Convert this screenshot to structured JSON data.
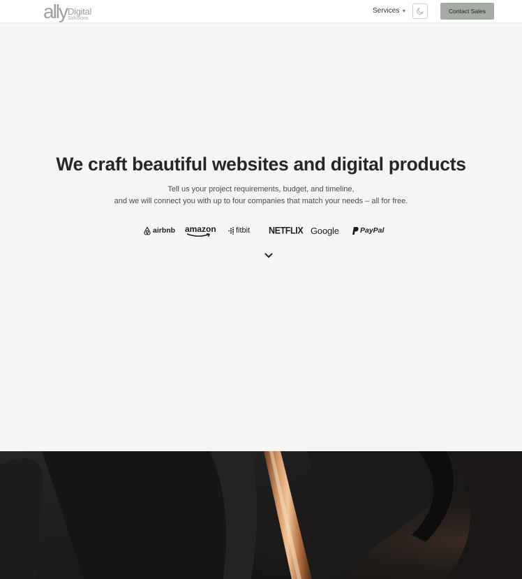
{
  "header": {
    "logo": {
      "main": "ally",
      "line1": "Digital",
      "line2": "Solutions"
    },
    "nav_services": "Services",
    "contact_button": "Contact Sales"
  },
  "hero": {
    "title": "We craft beautiful websites and digital products",
    "subtitle_line1": "Tell us your project requirements, budget, and timeline,",
    "subtitle_line2": "and we will connect you with up to four companies that match your needs – all for free."
  },
  "brands": [
    {
      "name": "airbnb",
      "icon": "airbnb-icon"
    },
    {
      "name": "amazon",
      "icon": "amazon-smile-icon"
    },
    {
      "name": "fitbit",
      "icon": "fitbit-dots-icon"
    },
    {
      "name": "NETFLIX"
    },
    {
      "name": "Google"
    },
    {
      "name": "PayPal",
      "icon": "paypal-p-icon"
    }
  ],
  "icons": {
    "theme_toggle": "moon-icon",
    "nav_chevron": "chevron-down-icon",
    "scroll": "chevron-down-icon"
  },
  "colors": {
    "background": "#f5f5f5",
    "header": "#ffffff",
    "contact_button": "#a4aba4",
    "title": "#262626",
    "photo_band": "#1a1a1a",
    "copper_accent": "#c98a5c"
  }
}
